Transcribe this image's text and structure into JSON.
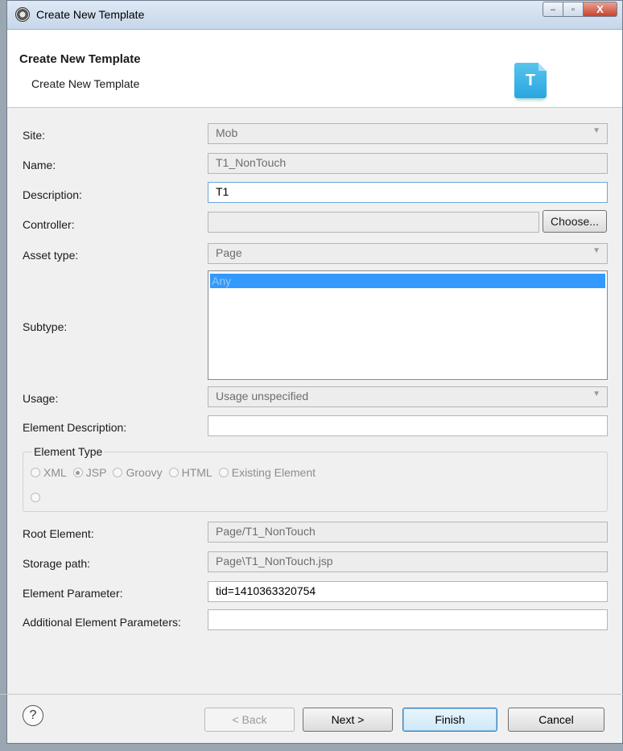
{
  "window": {
    "title": "Create New Template",
    "minimize": "–",
    "maximize": "▫",
    "close": "X"
  },
  "header": {
    "title": "Create New Template",
    "subtitle": "Create New Template",
    "icon_letter": "T"
  },
  "form": {
    "site": {
      "label": "Site:",
      "value": "Mob"
    },
    "name": {
      "label": "Name:",
      "value": "T1_NonTouch"
    },
    "description": {
      "label": "Description:",
      "value": "T1"
    },
    "controller": {
      "label": "Controller:",
      "value": "",
      "button": "Choose..."
    },
    "asset_type": {
      "label": "Asset type:",
      "value": "Page"
    },
    "subtype": {
      "label": "Subtype:",
      "items": [
        "Any"
      ]
    },
    "usage": {
      "label": "Usage:",
      "value": "Usage unspecified"
    },
    "element_description": {
      "label": "Element Description:",
      "value": ""
    },
    "element_type": {
      "label": "Element Type",
      "options": [
        "XML",
        "JSP",
        "Groovy",
        "HTML",
        "Existing Element"
      ],
      "selected": "JSP"
    },
    "root_element": {
      "label": "Root Element:",
      "value": "Page/T1_NonTouch"
    },
    "storage_path": {
      "label": "Storage path:",
      "value": "Page\\T1_NonTouch.jsp"
    },
    "element_parameter": {
      "label": "Element Parameter:",
      "value": "tid=1410363320754"
    },
    "additional_parameters": {
      "label": "Additional Element Parameters:",
      "value": ""
    }
  },
  "footer": {
    "help": "?",
    "back": "< Back",
    "next": "Next >",
    "finish": "Finish",
    "cancel": "Cancel"
  },
  "icons": {
    "app": "gear-icon",
    "help": "help-icon",
    "template": "template-file-icon",
    "dropdown": "chevron-down-icon"
  },
  "colors": {
    "selection": "#3399ff",
    "template_icon": "#2aa6e0"
  }
}
